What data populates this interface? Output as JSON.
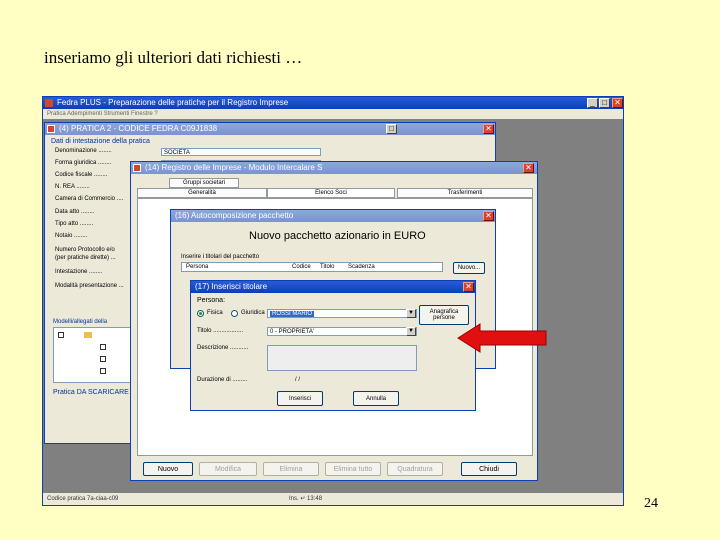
{
  "slide": {
    "title": "inseriamo gli ulteriori dati richiesti …",
    "page_number": "24"
  },
  "main_window": {
    "title": "Fedra PLUS - Preparazione delle pratiche per il Registro Imprese",
    "menu": "Pratica  Adempimenti  Strumenti  Finestre  ?",
    "status_left": "Codice pratica 7a-ciaa-c09",
    "status_right": "Ins. ↵ 13:48"
  },
  "window_pratica": {
    "title": "(4) PRATICA 2 - CODICE FEDRA C09J1838",
    "section_label": "Dati di intestazione della pratica",
    "fields": [
      "Denominazione ........",
      "Forma giuridica ........",
      "Codice fiscale ........",
      "N. REA ........",
      "Camera di Commercio ....",
      "Data atto ........",
      "Tipo atto ........",
      "Notaio ........"
    ],
    "field_value": "SOCIETA",
    "notes": [
      "Numero Protocollo e/o",
      "(per pratiche dirette) ...",
      "Intestazione ........",
      "Modalità presentazione ..."
    ],
    "models_label": "Modelli/allegati della",
    "footer_label": "Pratica DA SCARICARE"
  },
  "window_registro": {
    "title": "(14) Registro delle Imprese - Modulo Intercalare S",
    "group_tab": "Gruppi societari",
    "tabs": [
      "Generalità",
      "Elenco Soci",
      "Trasferimenti"
    ],
    "buttons": [
      "Nuovo",
      "Modifica",
      "Elimina",
      "Elimina tutto",
      "Quadratura",
      "Chiudi"
    ]
  },
  "window_autocomp": {
    "title": "(16) Autocomposizione pacchetto",
    "heading": "Nuovo pacchetto azionario in EURO",
    "subtitle": "Inserire i titolari del pacchetto",
    "columns": [
      "Persona",
      "Codice",
      "Titolo",
      "Scadenza"
    ],
    "new_button": "Nuovo..."
  },
  "window_titolare": {
    "title": "(17) Inserisci titolare",
    "persona_label": "Persona:",
    "radio_fisica": "Fisica",
    "radio_giuridica": "Giuridica",
    "persona_value": "ROSSI MARIO",
    "anagrafica_button": "Anagrafica persone",
    "titolo_label": "Titolo ..................",
    "titolo_value": "0 - PROPRIETA'",
    "descrizione_label": "Descrizione ...........",
    "durata_label": "Durazione di .........",
    "durata_value": "/ /",
    "inserisci_button": "Inserisci",
    "annulla_button": "Annulla"
  },
  "colors": {
    "slide_bg": "#ffffc4",
    "titlebar": "#0a3fb8",
    "arrow": "#e01010"
  }
}
